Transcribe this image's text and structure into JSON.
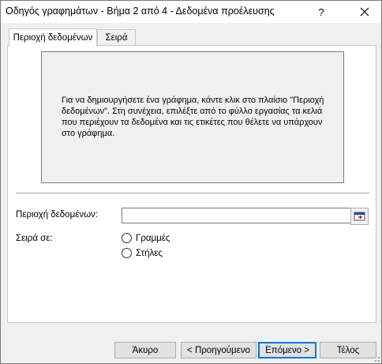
{
  "window": {
    "title": "Οδηγός γραφημάτων - Βήμα 2 από 4 - Δεδομένα προέλευσης",
    "help_label": "?",
    "close_label": "✕"
  },
  "tabs": [
    {
      "label": "Περιοχή δεδομένων",
      "active": true
    },
    {
      "label": "Σειρά",
      "active": false
    }
  ],
  "preview": {
    "message": "Για να δημιουργήσετε ένα γράφημα, κάντε κλικ στο πλαίσιο \"Περιοχή δεδομένων\". Στη συνέχεια, επιλέξτε από το φύλλο εργασίας τα κελιά που περιέχουν τα δεδομένα και τις ετικέτες που θέλετε να υπάρχουν στο γράφημα."
  },
  "data_range": {
    "label": "Περιοχή δεδομένων:",
    "value": ""
  },
  "series_in": {
    "label": "Σειρά σε:",
    "options": [
      {
        "label": "Γραμμές",
        "selected": false
      },
      {
        "label": "Στήλες",
        "selected": false
      }
    ]
  },
  "buttons": {
    "cancel": "Άκυρο",
    "back": "< Προηγούμενο",
    "next": "Επόμενο >",
    "finish": "Τέλος"
  },
  "colors": {
    "accent": "#0078d7",
    "panel_bg": "#ffffff",
    "window_bg": "#f0f0f0"
  }
}
